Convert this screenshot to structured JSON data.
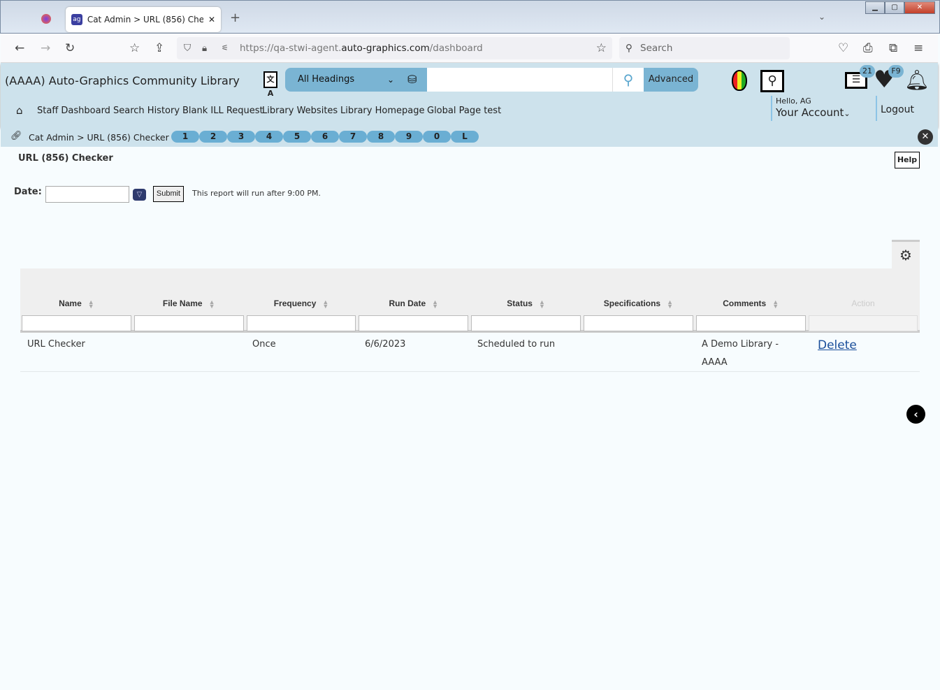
{
  "browser": {
    "tab_title": "Cat Admin > URL (856) Checker",
    "url_prefix": "https://qa-stwi-agent.",
    "url_domain": "auto-graphics.com",
    "url_path": "/dashboard",
    "search_placeholder": "Search"
  },
  "header": {
    "library_name": "(AAAA) Auto-Graphics Community Library",
    "search_type": "All Headings",
    "search_value": "",
    "advanced_label": "Advanced",
    "list_badge": "21",
    "fav_badge": "F9",
    "greeting": "Hello, AG",
    "account_label": "Your Account",
    "logout_label": "Logout"
  },
  "nav": [
    "Staff Dashboard",
    "Search History",
    "Blank ILL Request",
    "Library Websites",
    "Library Homepage",
    "Global Page test"
  ],
  "breadcrumb": {
    "text": "Cat Admin > URL (856) Checker",
    "letters": [
      "1",
      "2",
      "3",
      "4",
      "5",
      "6",
      "7",
      "8",
      "9",
      "0",
      "L"
    ]
  },
  "page": {
    "title": "URL (856) Checker",
    "help_label": "Help",
    "date_label": "Date:",
    "date_value": "",
    "submit_label": "Submit",
    "note": "This report will run after 9:00 PM."
  },
  "table": {
    "columns": [
      "Name",
      "File Name",
      "Frequency",
      "Run Date",
      "Status",
      "Specifications",
      "Comments",
      "Action"
    ],
    "rows": [
      {
        "name": "URL Checker",
        "file_name": "",
        "frequency": "Once",
        "run_date": "6/6/2023",
        "status": "Scheduled to run",
        "specifications": "",
        "comments_line1": "A Demo Library -",
        "comments_line2": "AAAA",
        "action": "Delete"
      }
    ]
  },
  "colors": {
    "header_bg": "#cde2ec",
    "accent": "#7ab4d3",
    "link": "#1a4e9a"
  }
}
